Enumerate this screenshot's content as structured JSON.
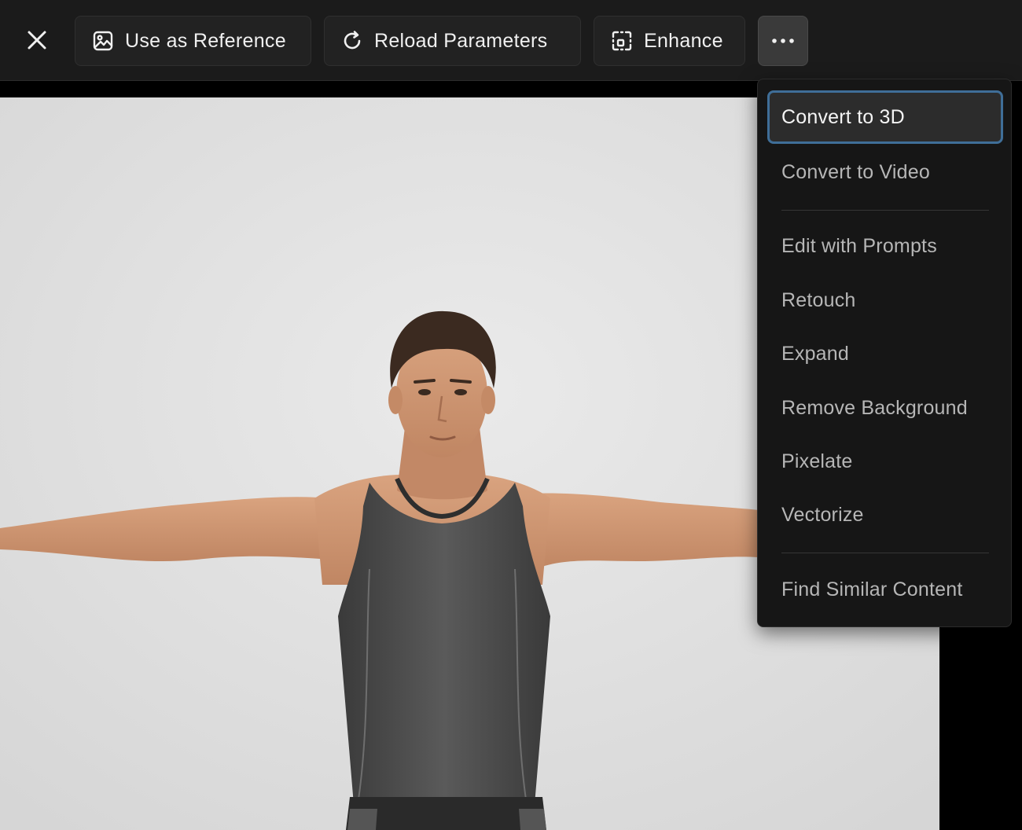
{
  "toolbar": {
    "close_icon": "close-icon",
    "use_as_reference": {
      "label": "Use as Reference",
      "icon": "image-icon"
    },
    "reload_parameters": {
      "label": "Reload Parameters",
      "icon": "refresh-icon"
    },
    "enhance": {
      "label": "Enhance",
      "icon": "enhance-frame-icon"
    },
    "more_icon": "more-horizontal-icon"
  },
  "menu": {
    "group1": [
      {
        "label": "Convert to 3D",
        "active": true
      },
      {
        "label": "Convert to Video",
        "active": false
      }
    ],
    "group2": [
      {
        "label": "Edit with Prompts"
      },
      {
        "label": "Retouch"
      },
      {
        "label": "Expand"
      },
      {
        "label": "Remove Background"
      },
      {
        "label": "Pixelate"
      },
      {
        "label": "Vectorize"
      }
    ],
    "group3": [
      {
        "label": "Find Similar Content"
      }
    ]
  },
  "colors": {
    "toolbar_bg": "#1b1b1b",
    "menu_bg": "#161616",
    "active_border": "#3f6e98",
    "canvas_bg": "#e0e0e0"
  }
}
